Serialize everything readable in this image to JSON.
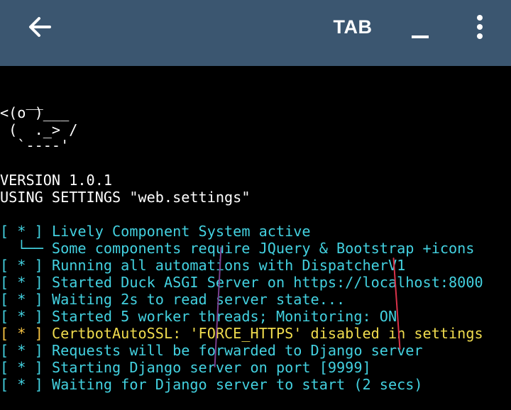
{
  "toolbar": {
    "tab_label": "TAB",
    "back_icon": "arrow-left-icon",
    "minimize_icon": "minimize-icon",
    "more_icon": "more-vert-icon",
    "background_color": "#3b5670"
  },
  "terminal": {
    "logo": [
      "   __",
      "<(o )___",
      " (  ._> /",
      "  `----'"
    ],
    "version_line": "VERSION 1.0.1",
    "settings_label": "USING SETTINGS",
    "settings_value": "\"web.settings\"",
    "log": [
      {
        "bullet": "[ * ]",
        "text": "Lively Component System active",
        "color": "cyan"
      },
      {
        "bullet": "",
        "text": "  └── Some components require JQuery & Bootstrap +icons",
        "color": "cyan"
      },
      {
        "bullet": "[ * ]",
        "text": "Running all automations with DispatcherV1",
        "color": "cyan"
      },
      {
        "bullet": "[ * ]",
        "text": "Started Duck ASGI Server on https://localhost:8000",
        "color": "cyan"
      },
      {
        "bullet": "[ * ]",
        "text": "Waiting 2s to read server state...",
        "color": "cyan"
      },
      {
        "bullet": "[ * ]",
        "text": "Started 5 worker threads; Monitoring: ON",
        "color": "cyan"
      },
      {
        "bullet": "[ * ]",
        "text": "CertbotAutoSSL: 'FORCE_HTTPS' disabled in settings",
        "color": "yellow"
      },
      {
        "bullet": "[ * ]",
        "text": "Requests will be forwarded to Django server",
        "color": "cyan"
      },
      {
        "bullet": "[ * ]",
        "text": "Starting Django server on port [9999]",
        "color": "cyan"
      },
      {
        "bullet": "[ * ]",
        "text": "Waiting for Django server to start (2 secs)",
        "color": "cyan"
      }
    ],
    "colors": {
      "cyan": "#43d1e0",
      "yellow": "#f0dc4e",
      "amber": "#f6c343",
      "white": "#ffffff",
      "background": "#000000"
    }
  }
}
